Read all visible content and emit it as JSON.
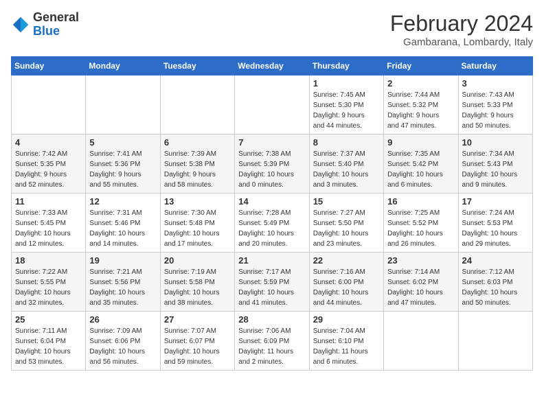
{
  "logo": {
    "text_general": "General",
    "text_blue": "Blue"
  },
  "title": {
    "main": "February 2024",
    "sub": "Gambarana, Lombardy, Italy"
  },
  "weekdays": [
    "Sunday",
    "Monday",
    "Tuesday",
    "Wednesday",
    "Thursday",
    "Friday",
    "Saturday"
  ],
  "weeks": [
    [
      {
        "day": "",
        "info": ""
      },
      {
        "day": "",
        "info": ""
      },
      {
        "day": "",
        "info": ""
      },
      {
        "day": "",
        "info": ""
      },
      {
        "day": "1",
        "info": "Sunrise: 7:45 AM\nSunset: 5:30 PM\nDaylight: 9 hours\nand 44 minutes."
      },
      {
        "day": "2",
        "info": "Sunrise: 7:44 AM\nSunset: 5:32 PM\nDaylight: 9 hours\nand 47 minutes."
      },
      {
        "day": "3",
        "info": "Sunrise: 7:43 AM\nSunset: 5:33 PM\nDaylight: 9 hours\nand 50 minutes."
      }
    ],
    [
      {
        "day": "4",
        "info": "Sunrise: 7:42 AM\nSunset: 5:35 PM\nDaylight: 9 hours\nand 52 minutes."
      },
      {
        "day": "5",
        "info": "Sunrise: 7:41 AM\nSunset: 5:36 PM\nDaylight: 9 hours\nand 55 minutes."
      },
      {
        "day": "6",
        "info": "Sunrise: 7:39 AM\nSunset: 5:38 PM\nDaylight: 9 hours\nand 58 minutes."
      },
      {
        "day": "7",
        "info": "Sunrise: 7:38 AM\nSunset: 5:39 PM\nDaylight: 10 hours\nand 0 minutes."
      },
      {
        "day": "8",
        "info": "Sunrise: 7:37 AM\nSunset: 5:40 PM\nDaylight: 10 hours\nand 3 minutes."
      },
      {
        "day": "9",
        "info": "Sunrise: 7:35 AM\nSunset: 5:42 PM\nDaylight: 10 hours\nand 6 minutes."
      },
      {
        "day": "10",
        "info": "Sunrise: 7:34 AM\nSunset: 5:43 PM\nDaylight: 10 hours\nand 9 minutes."
      }
    ],
    [
      {
        "day": "11",
        "info": "Sunrise: 7:33 AM\nSunset: 5:45 PM\nDaylight: 10 hours\nand 12 minutes."
      },
      {
        "day": "12",
        "info": "Sunrise: 7:31 AM\nSunset: 5:46 PM\nDaylight: 10 hours\nand 14 minutes."
      },
      {
        "day": "13",
        "info": "Sunrise: 7:30 AM\nSunset: 5:48 PM\nDaylight: 10 hours\nand 17 minutes."
      },
      {
        "day": "14",
        "info": "Sunrise: 7:28 AM\nSunset: 5:49 PM\nDaylight: 10 hours\nand 20 minutes."
      },
      {
        "day": "15",
        "info": "Sunrise: 7:27 AM\nSunset: 5:50 PM\nDaylight: 10 hours\nand 23 minutes."
      },
      {
        "day": "16",
        "info": "Sunrise: 7:25 AM\nSunset: 5:52 PM\nDaylight: 10 hours\nand 26 minutes."
      },
      {
        "day": "17",
        "info": "Sunrise: 7:24 AM\nSunset: 5:53 PM\nDaylight: 10 hours\nand 29 minutes."
      }
    ],
    [
      {
        "day": "18",
        "info": "Sunrise: 7:22 AM\nSunset: 5:55 PM\nDaylight: 10 hours\nand 32 minutes."
      },
      {
        "day": "19",
        "info": "Sunrise: 7:21 AM\nSunset: 5:56 PM\nDaylight: 10 hours\nand 35 minutes."
      },
      {
        "day": "20",
        "info": "Sunrise: 7:19 AM\nSunset: 5:58 PM\nDaylight: 10 hours\nand 38 minutes."
      },
      {
        "day": "21",
        "info": "Sunrise: 7:17 AM\nSunset: 5:59 PM\nDaylight: 10 hours\nand 41 minutes."
      },
      {
        "day": "22",
        "info": "Sunrise: 7:16 AM\nSunset: 6:00 PM\nDaylight: 10 hours\nand 44 minutes."
      },
      {
        "day": "23",
        "info": "Sunrise: 7:14 AM\nSunset: 6:02 PM\nDaylight: 10 hours\nand 47 minutes."
      },
      {
        "day": "24",
        "info": "Sunrise: 7:12 AM\nSunset: 6:03 PM\nDaylight: 10 hours\nand 50 minutes."
      }
    ],
    [
      {
        "day": "25",
        "info": "Sunrise: 7:11 AM\nSunset: 6:04 PM\nDaylight: 10 hours\nand 53 minutes."
      },
      {
        "day": "26",
        "info": "Sunrise: 7:09 AM\nSunset: 6:06 PM\nDaylight: 10 hours\nand 56 minutes."
      },
      {
        "day": "27",
        "info": "Sunrise: 7:07 AM\nSunset: 6:07 PM\nDaylight: 10 hours\nand 59 minutes."
      },
      {
        "day": "28",
        "info": "Sunrise: 7:06 AM\nSunset: 6:09 PM\nDaylight: 11 hours\nand 2 minutes."
      },
      {
        "day": "29",
        "info": "Sunrise: 7:04 AM\nSunset: 6:10 PM\nDaylight: 11 hours\nand 6 minutes."
      },
      {
        "day": "",
        "info": ""
      },
      {
        "day": "",
        "info": ""
      }
    ]
  ]
}
